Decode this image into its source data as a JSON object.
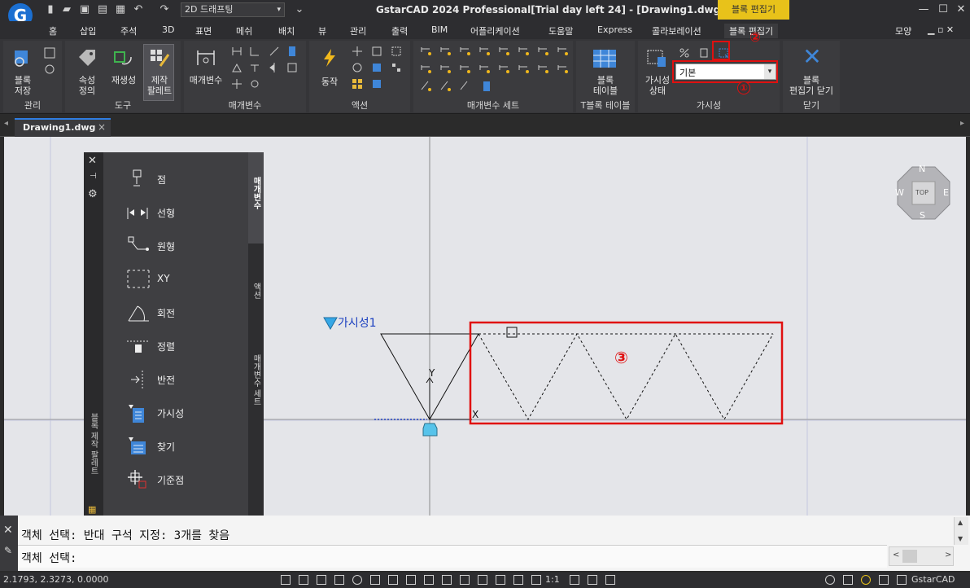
{
  "title_bar": {
    "logo": "G",
    "workspace": "2D 드래프팅",
    "app_title": "GstarCAD 2024 Professional[Trial day left 24] - [Drawing1.dwg]",
    "context_badge": "블록 편집기",
    "icons": [
      "new-file-icon",
      "open-folder-icon",
      "save-icon",
      "save-as-icon",
      "print-icon",
      "undo-icon",
      "redo-icon",
      "dropdown-icon",
      "minimize-icon",
      "restore-icon",
      "close-icon"
    ]
  },
  "menu_tabs": [
    "홈",
    "삽입",
    "주석",
    "3D",
    "표면",
    "메쉬",
    "배치",
    "뷰",
    "관리",
    "출력",
    "BIM",
    "어플리케이션",
    "도움말",
    "Express",
    "콜라보레이션",
    "블록 편집기"
  ],
  "menu_right": "모양",
  "ribbon": {
    "panels": [
      {
        "title": "관리",
        "buttons": [
          "블록\n저장"
        ]
      },
      {
        "title": "도구",
        "buttons": [
          "속성\n정의",
          "재생성",
          "제작\n팔레트"
        ]
      },
      {
        "title": "매개변수",
        "buttons": [
          "매개변수"
        ]
      },
      {
        "title": "액션",
        "buttons": [
          "동작"
        ]
      },
      {
        "title": "매개변수 세트",
        "buttons": []
      },
      {
        "title": "T블록 테이블",
        "buttons": [
          "블록\n테이블"
        ]
      },
      {
        "title": "가시성",
        "buttons": [
          "가시성\n상태"
        ],
        "state_dropdown": "기본"
      },
      {
        "title": "닫기",
        "buttons": [
          "블록\n편집기 닫기"
        ]
      }
    ]
  },
  "annotations": {
    "one": "①",
    "two": "②",
    "three": "③"
  },
  "doc_tab": {
    "label": "Drawing1.dwg",
    "close": "×"
  },
  "palette": {
    "items": [
      "점",
      "선형",
      "원형",
      "XY",
      "회전",
      "정렬",
      "반전",
      "가시성",
      "찾기",
      "기준점"
    ],
    "tabs": [
      "매개변수",
      "액션",
      "매개변수 세트"
    ],
    "side_title": "블록 제작 팔레트"
  },
  "drawing": {
    "visibility_label": "가시성1",
    "axis_x": "X",
    "axis_y": "Y"
  },
  "viewcube": {
    "top": "TOP",
    "n": "N",
    "s": "S",
    "e": "E",
    "w": "W"
  },
  "command": {
    "line1": "객체 선택: 반대 구석 지정: 3개를 찾음",
    "line2": "객체 선택:"
  },
  "status": {
    "coords": "2.1793, 2.3273, 0.0000",
    "scale": "1:1",
    "app_name": "GstarCAD"
  },
  "colors": {
    "accent": "#2f7de1",
    "highlight_red": "#e01010",
    "badge": "#e8c21a"
  }
}
